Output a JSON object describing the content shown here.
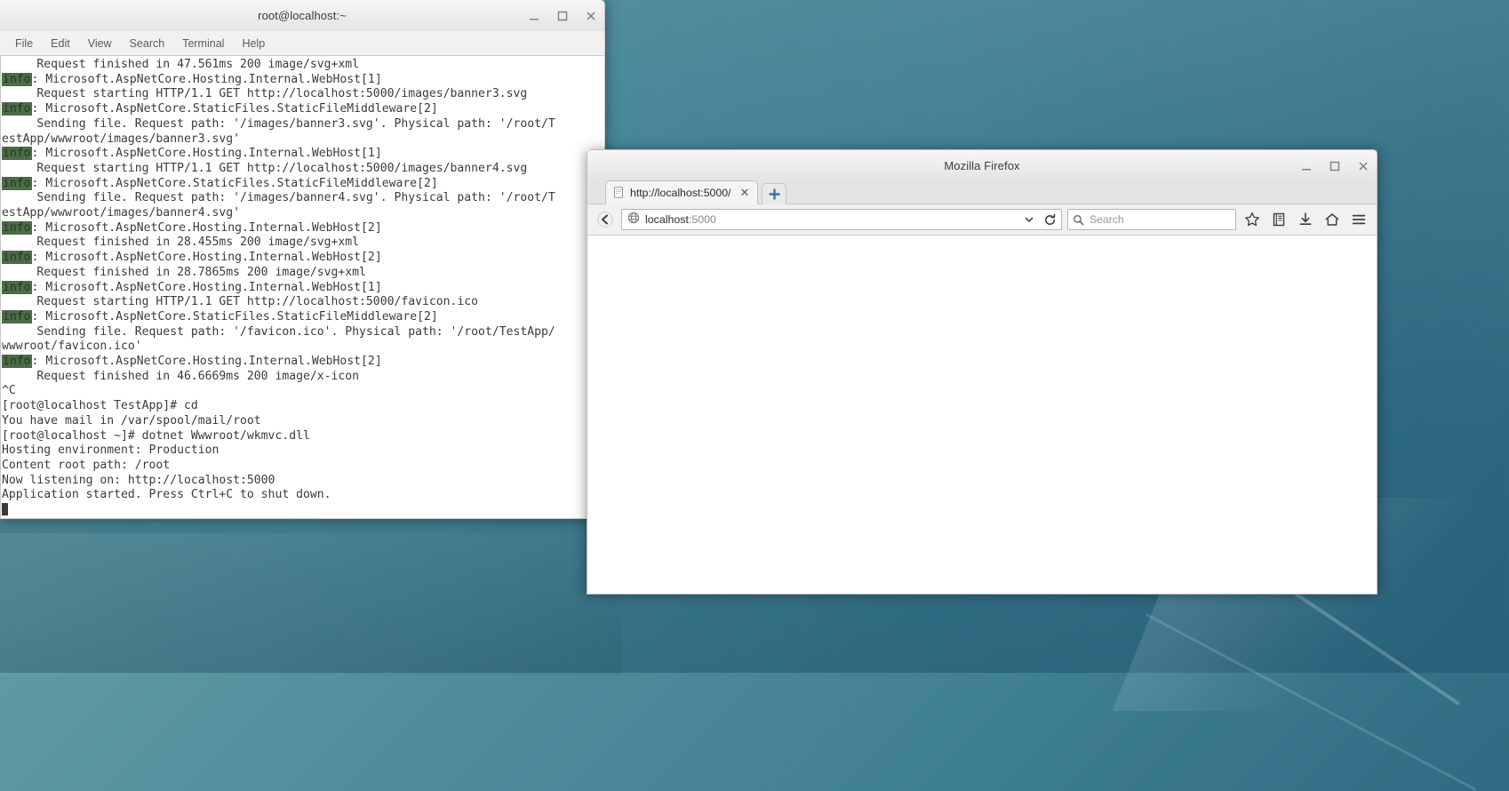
{
  "desktop": {
    "wallpaper_color": "#3f7f92"
  },
  "terminal": {
    "title": "root@localhost:~",
    "menus": [
      {
        "label": "File"
      },
      {
        "label": "Edit"
      },
      {
        "label": "View"
      },
      {
        "label": "Search"
      },
      {
        "label": "Terminal"
      },
      {
        "label": "Help"
      }
    ],
    "window_buttons": {
      "minimize": "minimize-button",
      "maximize": "maximize-button",
      "close": "close-button"
    },
    "colors": {
      "info_badge_bg": "#4e6a4a",
      "info_badge_fg": "#1d3a1a",
      "text": "#3b3b3b",
      "bg": "#ffffff"
    },
    "lines": [
      {
        "type": "plain",
        "text": "     Request finished in 47.561ms 200 image/svg+xml"
      },
      {
        "type": "info",
        "badge": "info",
        "text": ": Microsoft.AspNetCore.Hosting.Internal.WebHost[1]"
      },
      {
        "type": "plain",
        "text": "     Request starting HTTP/1.1 GET http://localhost:5000/images/banner3.svg"
      },
      {
        "type": "info",
        "badge": "info",
        "text": ": Microsoft.AspNetCore.StaticFiles.StaticFileMiddleware[2]"
      },
      {
        "type": "plain",
        "text": "     Sending file. Request path: '/images/banner3.svg'. Physical path: '/root/T"
      },
      {
        "type": "plain",
        "text": "estApp/wwwroot/images/banner3.svg'"
      },
      {
        "type": "info",
        "badge": "info",
        "text": ": Microsoft.AspNetCore.Hosting.Internal.WebHost[1]"
      },
      {
        "type": "plain",
        "text": "     Request starting HTTP/1.1 GET http://localhost:5000/images/banner4.svg"
      },
      {
        "type": "info",
        "badge": "info",
        "text": ": Microsoft.AspNetCore.StaticFiles.StaticFileMiddleware[2]"
      },
      {
        "type": "plain",
        "text": "     Sending file. Request path: '/images/banner4.svg'. Physical path: '/root/T"
      },
      {
        "type": "plain",
        "text": "estApp/wwwroot/images/banner4.svg'"
      },
      {
        "type": "info",
        "badge": "info",
        "text": ": Microsoft.AspNetCore.Hosting.Internal.WebHost[2]"
      },
      {
        "type": "plain",
        "text": "     Request finished in 28.455ms 200 image/svg+xml"
      },
      {
        "type": "info",
        "badge": "info",
        "text": ": Microsoft.AspNetCore.Hosting.Internal.WebHost[2]"
      },
      {
        "type": "plain",
        "text": "     Request finished in 28.7865ms 200 image/svg+xml"
      },
      {
        "type": "info",
        "badge": "info",
        "text": ": Microsoft.AspNetCore.Hosting.Internal.WebHost[1]"
      },
      {
        "type": "plain",
        "text": "     Request starting HTTP/1.1 GET http://localhost:5000/favicon.ico"
      },
      {
        "type": "info",
        "badge": "info",
        "text": ": Microsoft.AspNetCore.StaticFiles.StaticFileMiddleware[2]"
      },
      {
        "type": "plain",
        "text": "     Sending file. Request path: '/favicon.ico'. Physical path: '/root/TestApp/"
      },
      {
        "type": "plain",
        "text": "wwwroot/favicon.ico'"
      },
      {
        "type": "info",
        "badge": "info",
        "text": ": Microsoft.AspNetCore.Hosting.Internal.WebHost[2]"
      },
      {
        "type": "plain",
        "text": "     Request finished in 46.6669ms 200 image/x-icon"
      },
      {
        "type": "plain",
        "text": "^C"
      },
      {
        "type": "plain",
        "text": "[root@localhost TestApp]# cd"
      },
      {
        "type": "plain",
        "text": "You have mail in /var/spool/mail/root"
      },
      {
        "type": "plain",
        "text": "[root@localhost ~]# dotnet Wwwroot/wkmvc.dll"
      },
      {
        "type": "plain",
        "text": "Hosting environment: Production"
      },
      {
        "type": "plain",
        "text": "Content root path: /root"
      },
      {
        "type": "plain",
        "text": "Now listening on: http://localhost:5000"
      },
      {
        "type": "plain",
        "text": "Application started. Press Ctrl+C to shut down."
      },
      {
        "type": "cursor",
        "text": ""
      }
    ]
  },
  "firefox": {
    "title": "Mozilla Firefox",
    "window_buttons": {
      "minimize": "minimize-button",
      "maximize": "maximize-button",
      "close": "close-button"
    },
    "tabs": [
      {
        "label": "http://localhost:5000/",
        "close_label": "✕",
        "favicon": "page-icon",
        "active": true
      }
    ],
    "new_tab_label": "+",
    "toolbar": {
      "back_label": "Back",
      "url_scheme": "localhost",
      "url_path": ":5000",
      "url_full": "localhost:5000",
      "dropdown_label": "▾",
      "reload_label": "Reload",
      "search_placeholder": "Search",
      "bookmark_label": "Bookmark this page",
      "library_label": "Show your library",
      "downloads_label": "Downloads",
      "home_label": "Home",
      "menu_label": "Open menu"
    },
    "content": {
      "page_blank": true
    }
  }
}
